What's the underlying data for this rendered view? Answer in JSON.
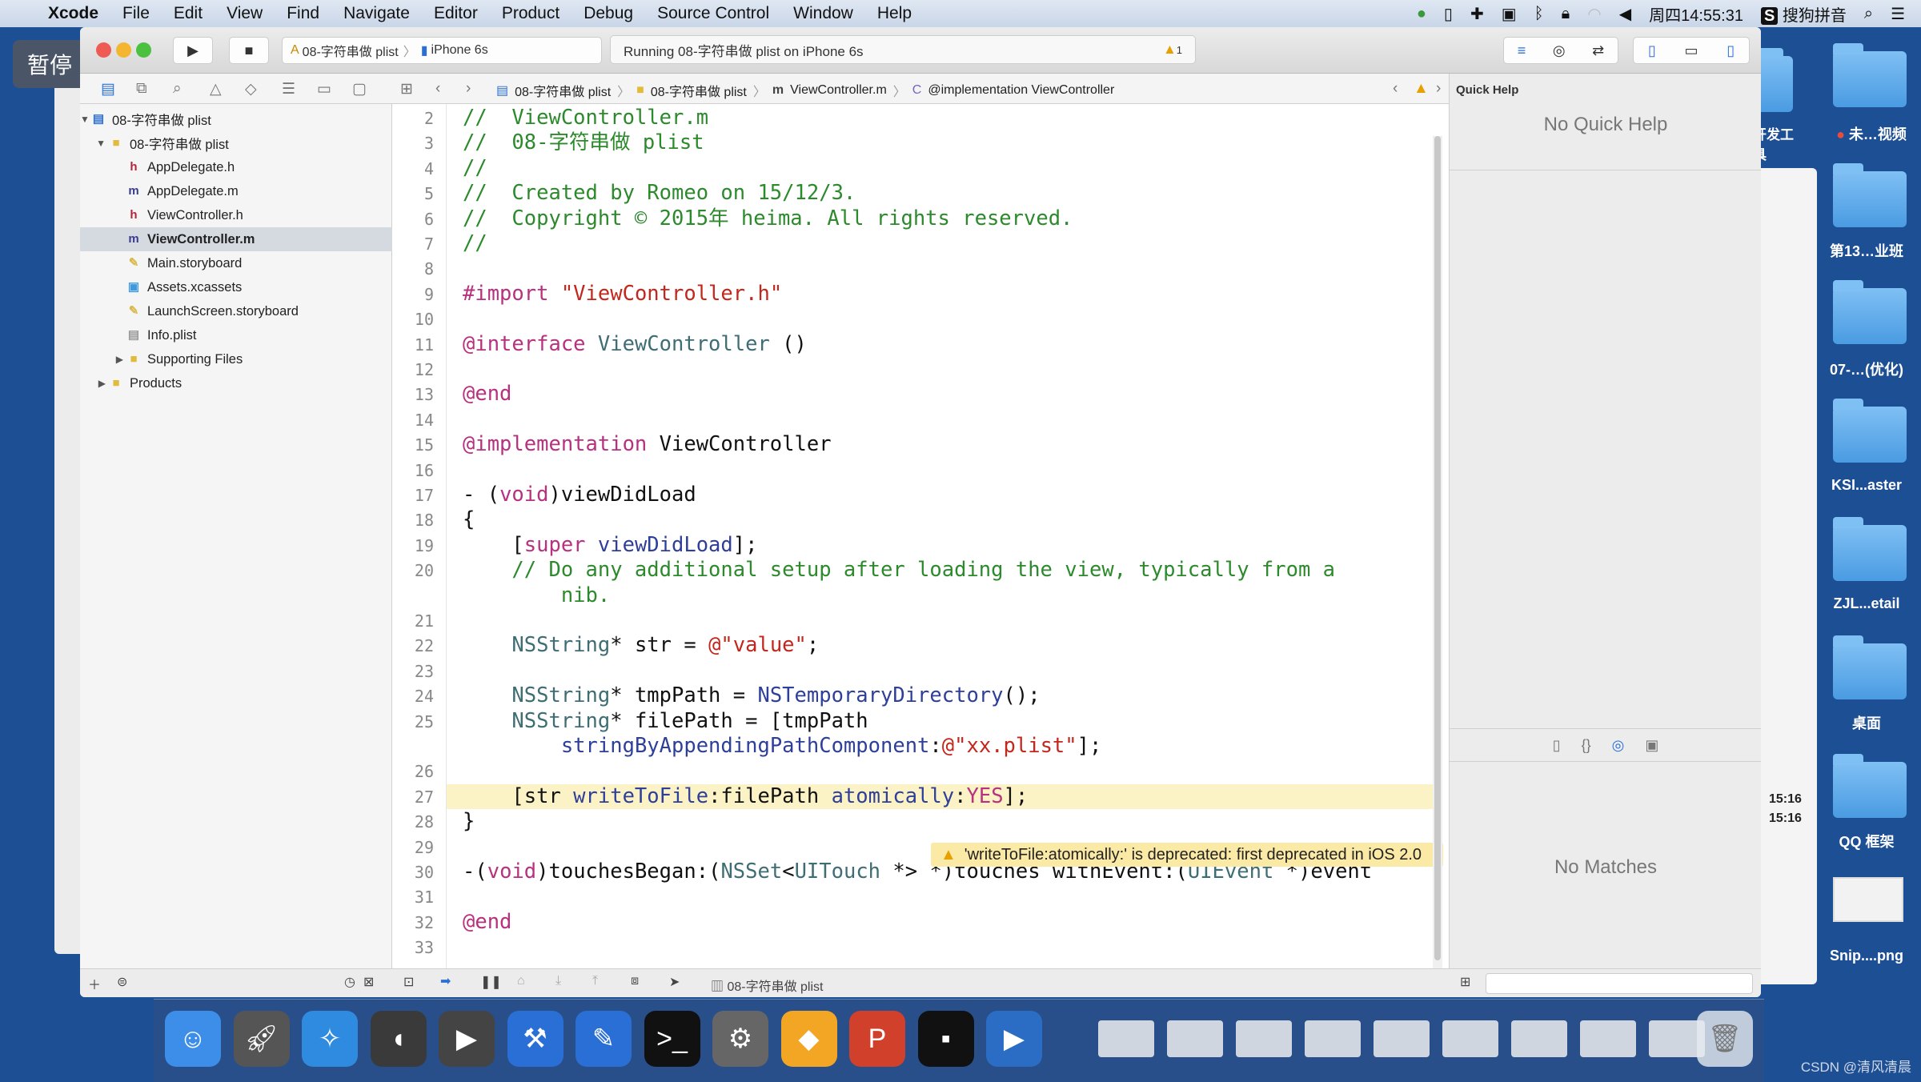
{
  "overlay": {
    "pause_label": "暂停"
  },
  "menubar": {
    "app": "Xcode",
    "items": [
      "File",
      "Edit",
      "View",
      "Find",
      "Navigate",
      "Editor",
      "Product",
      "Debug",
      "Source Control",
      "Window",
      "Help"
    ],
    "clock": "周四14:55:31",
    "ime": "搜狗拼音"
  },
  "toolbar": {
    "scheme": "08-字符串做 plist",
    "device": "iPhone 6s",
    "status": "Running 08-字符串做 plist on iPhone 6s",
    "warning_count": "1"
  },
  "jumpbar": {
    "crumbs": [
      "08-字符串做 plist",
      "08-字符串做 plist",
      "ViewController.m",
      "@implementation ViewController"
    ]
  },
  "navigator": {
    "items": [
      {
        "label": "08-字符串做 plist",
        "icon": "project-icon",
        "level": 0,
        "disclosure": "open"
      },
      {
        "label": "08-字符串做 plist",
        "icon": "folder-icon",
        "level": 1,
        "disclosure": "open"
      },
      {
        "label": "AppDelegate.h",
        "icon": "h",
        "level": 2
      },
      {
        "label": "AppDelegate.m",
        "icon": "m",
        "level": 2
      },
      {
        "label": "ViewController.h",
        "icon": "h",
        "level": 2
      },
      {
        "label": "ViewController.m",
        "icon": "m",
        "level": 2,
        "selected": true
      },
      {
        "label": "Main.storyboard",
        "icon": "storyboard-icon",
        "level": 2
      },
      {
        "label": "Assets.xcassets",
        "icon": "assets-icon",
        "level": 2
      },
      {
        "label": "LaunchScreen.storyboard",
        "icon": "storyboard-icon",
        "level": 2
      },
      {
        "label": "Info.plist",
        "icon": "plist-icon",
        "level": 2
      },
      {
        "label": "Supporting Files",
        "icon": "folder-icon",
        "level": 2,
        "disclosure": "closed"
      },
      {
        "label": "Products",
        "icon": "folder-icon",
        "level": 1,
        "disclosure": "closed"
      }
    ]
  },
  "editor": {
    "highlighted_line": "27",
    "warning": "'writeToFile:atomically:' is deprecated: first deprecated in iOS 2.0",
    "lines": [
      {
        "n": "2",
        "s": [
          [
            "com",
            "//  ViewController.m"
          ]
        ]
      },
      {
        "n": "3",
        "s": [
          [
            "com",
            "//  08-字符串做 plist"
          ]
        ]
      },
      {
        "n": "4",
        "s": [
          [
            "com",
            "//"
          ]
        ]
      },
      {
        "n": "5",
        "s": [
          [
            "com",
            "//  Created by Romeo on 15/12/3."
          ]
        ]
      },
      {
        "n": "6",
        "s": [
          [
            "com",
            "//  Copyright © 2015年 heima. All rights reserved."
          ]
        ]
      },
      {
        "n": "7",
        "s": [
          [
            "com",
            "//"
          ]
        ]
      },
      {
        "n": "8",
        "s": []
      },
      {
        "n": "9",
        "s": [
          [
            "kw",
            "#import "
          ],
          [
            "str",
            "\"ViewController.h\""
          ]
        ]
      },
      {
        "n": "10",
        "s": []
      },
      {
        "n": "11",
        "s": [
          [
            "kw",
            "@interface "
          ],
          [
            "cls",
            "ViewController"
          ],
          [
            "txt",
            " ()"
          ]
        ]
      },
      {
        "n": "12",
        "s": []
      },
      {
        "n": "13",
        "s": [
          [
            "kw",
            "@end"
          ]
        ]
      },
      {
        "n": "14",
        "s": []
      },
      {
        "n": "15",
        "s": [
          [
            "kw",
            "@implementation "
          ],
          [
            "txt",
            "ViewController"
          ]
        ]
      },
      {
        "n": "16",
        "s": []
      },
      {
        "n": "17",
        "s": [
          [
            "txt",
            "- ("
          ],
          [
            "kw",
            "void"
          ],
          [
            "txt",
            ")viewDidLoad"
          ]
        ]
      },
      {
        "n": "18",
        "s": [
          [
            "txt",
            "{"
          ]
        ]
      },
      {
        "n": "19",
        "s": [
          [
            "txt",
            "    ["
          ],
          [
            "kw",
            "super"
          ],
          [
            "txt",
            " "
          ],
          [
            "meth",
            "viewDidLoad"
          ],
          [
            "txt",
            "];"
          ]
        ]
      },
      {
        "n": "20",
        "s": [
          [
            "com",
            "    // Do any additional setup after loading the view, typically from a"
          ]
        ]
      },
      {
        "n": "",
        "s": [
          [
            "com",
            "        nib."
          ]
        ]
      },
      {
        "n": "21",
        "s": []
      },
      {
        "n": "22",
        "s": [
          [
            "cls",
            "    NSString"
          ],
          [
            "txt",
            "* str = "
          ],
          [
            "str",
            "@\"value\""
          ],
          [
            "txt",
            ";"
          ]
        ]
      },
      {
        "n": "23",
        "s": []
      },
      {
        "n": "24",
        "s": [
          [
            "cls",
            "    NSString"
          ],
          [
            "txt",
            "* tmpPath = "
          ],
          [
            "meth",
            "NSTemporaryDirectory"
          ],
          [
            "txt",
            "();"
          ]
        ]
      },
      {
        "n": "25",
        "s": [
          [
            "cls",
            "    NSString"
          ],
          [
            "txt",
            "* filePath = [tmpPath"
          ]
        ]
      },
      {
        "n": "",
        "s": [
          [
            "txt",
            "        "
          ],
          [
            "meth",
            "stringByAppendingPathComponent"
          ],
          [
            "txt",
            ":"
          ],
          [
            "str",
            "@\"xx.plist\""
          ],
          [
            "txt",
            "];"
          ]
        ]
      },
      {
        "n": "26",
        "s": []
      },
      {
        "n": "27",
        "s": [
          [
            "txt",
            "    [str "
          ],
          [
            "meth",
            "writeToFile"
          ],
          [
            "txt",
            ":filePath "
          ],
          [
            "meth",
            "atomically"
          ],
          [
            "txt",
            ":"
          ],
          [
            "kw",
            "YES"
          ],
          [
            "txt",
            "];"
          ]
        ]
      },
      {
        "n": "28",
        "s": [
          [
            "txt",
            "}"
          ]
        ]
      },
      {
        "n": "29",
        "s": []
      },
      {
        "n": "30",
        "s": [
          [
            "txt",
            "-("
          ],
          [
            "kw",
            "void"
          ],
          [
            "txt",
            ")touchesBegan:("
          ],
          [
            "cls",
            "NSSet"
          ],
          [
            "txt",
            "<"
          ],
          [
            "cls",
            "UITouch"
          ],
          [
            "txt",
            " *> *)touches withEvent:("
          ],
          [
            "cls",
            "UIEvent"
          ],
          [
            "txt",
            " *)event"
          ]
        ]
      },
      {
        "n": "31",
        "s": []
      },
      {
        "n": "32",
        "s": [
          [
            "kw",
            "@end"
          ]
        ]
      },
      {
        "n": "33",
        "s": []
      }
    ]
  },
  "inspector": {
    "title": "Quick Help",
    "quick_help": "No Quick Help",
    "library": "No Matches"
  },
  "debugbar": {
    "target": "08-字符串做 plist"
  },
  "desktop": {
    "icons": [
      "开发工具",
      "未…视频",
      "第13…业班",
      "07-…(优化)",
      "KSI...aster",
      "ZJL...etail",
      "桌面",
      "QQ 框架",
      "Snip....png"
    ],
    "times": [
      "15:16",
      "15:16"
    ]
  },
  "watermark": "CSDN @清风清晨"
}
